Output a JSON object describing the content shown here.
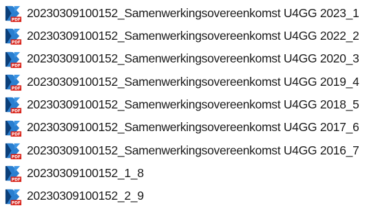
{
  "file_list": {
    "icon": "kofax-pdf-file-icon",
    "colors": {
      "icon_blue": "#2a7fd0",
      "icon_dark": "#0b3f7a",
      "icon_red": "#d9251c",
      "text": "#1a1a1a"
    },
    "items": [
      {
        "name": "20230309100152_Samenwerkingsovereenkomst U4GG 2023_1"
      },
      {
        "name": "20230309100152_Samenwerkingsovereenkomst U4GG 2022_2"
      },
      {
        "name": "20230309100152_Samenwerkingsovereenkomst U4GG 2020_3"
      },
      {
        "name": "20230309100152_Samenwerkingsovereenkomst U4GG 2019_4"
      },
      {
        "name": "20230309100152_Samenwerkingsovereenkomst U4GG 2018_5"
      },
      {
        "name": "20230309100152_Samenwerkingsovereenkomst U4GG 2017_6"
      },
      {
        "name": "20230309100152_Samenwerkingsovereenkomst U4GG 2016_7"
      },
      {
        "name": "20230309100152_1_8"
      },
      {
        "name": "20230309100152_2_9"
      }
    ]
  }
}
